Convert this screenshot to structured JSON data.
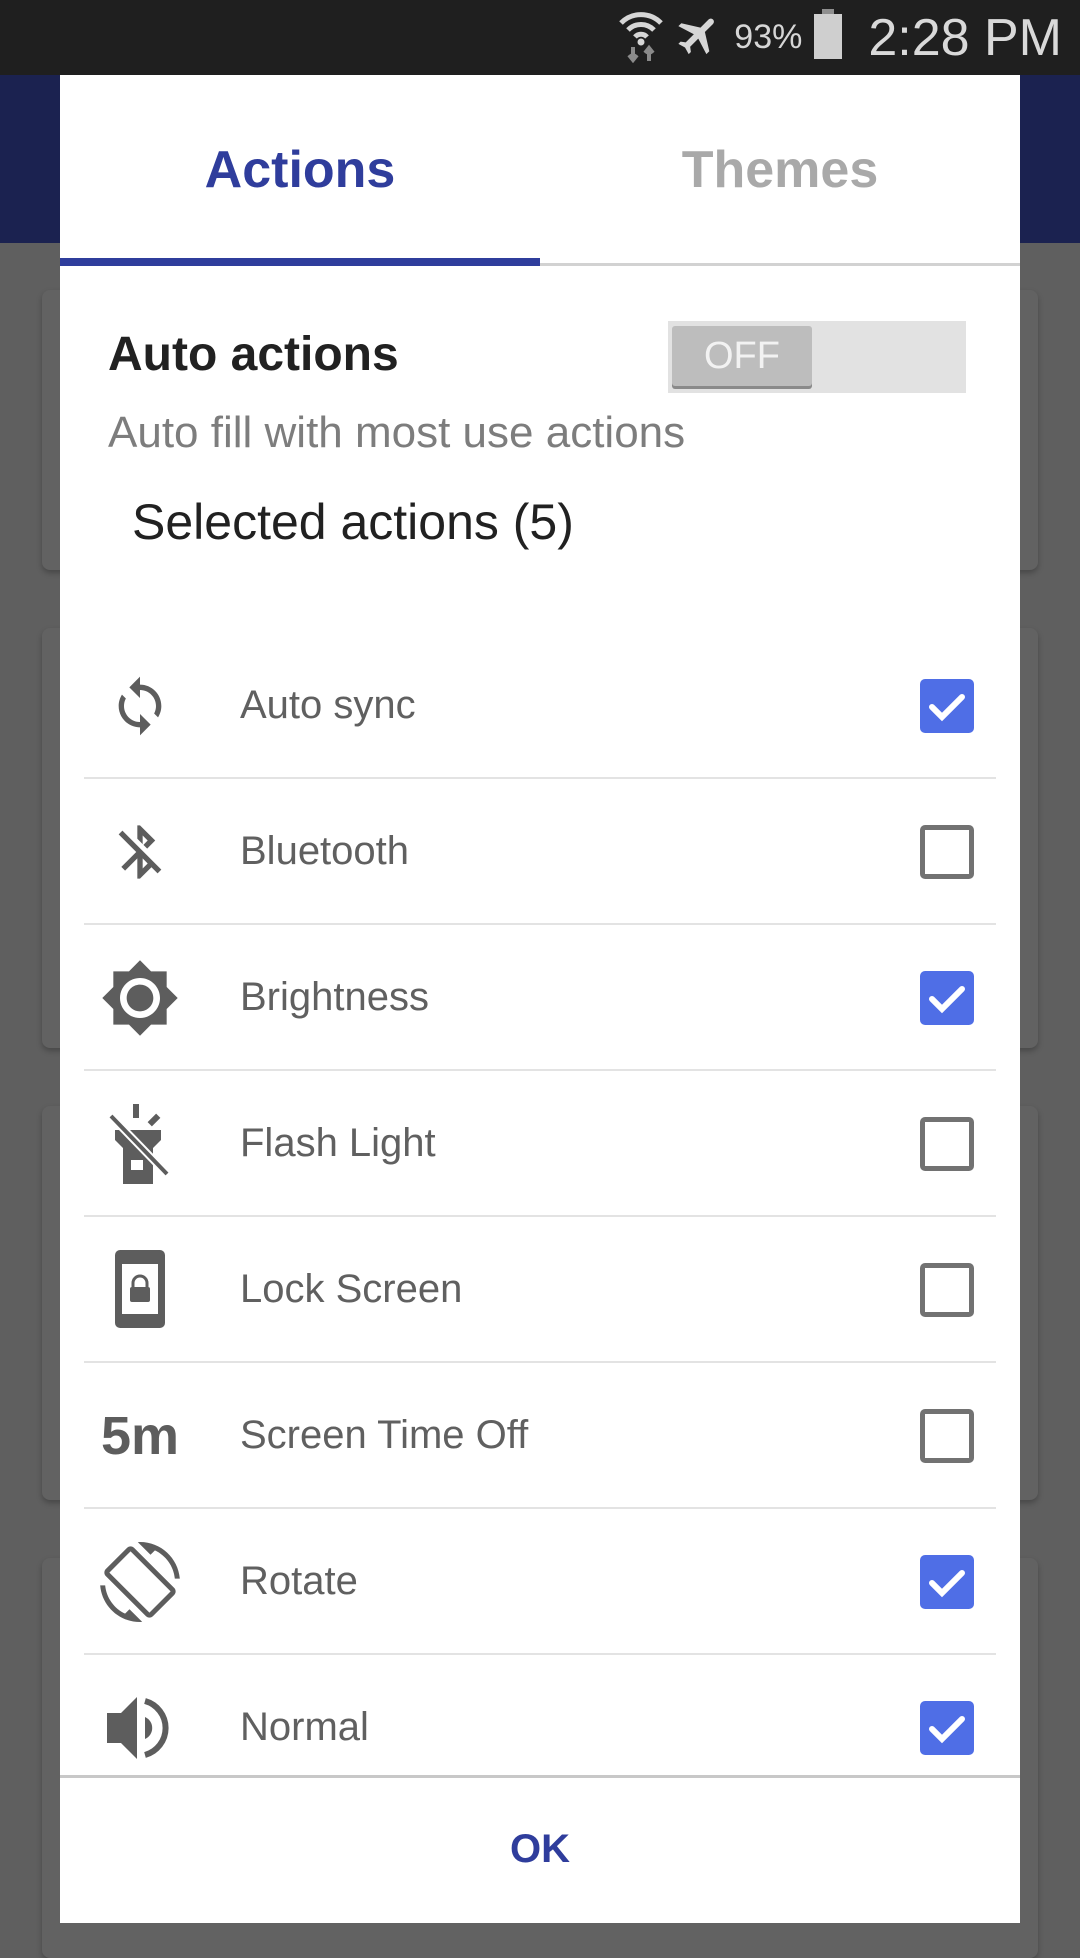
{
  "status_bar": {
    "battery_percent": "93%",
    "time": "2:28 PM",
    "icons": [
      "wifi-data-icon",
      "airplane-mode-icon",
      "battery-icon"
    ]
  },
  "tabs": [
    {
      "label": "Actions",
      "active": true
    },
    {
      "label": "Themes",
      "active": false
    }
  ],
  "auto_actions": {
    "title": "Auto actions",
    "subtitle": "Auto fill with most use actions",
    "toggle_label": "OFF",
    "toggle_on": false
  },
  "selected_actions": {
    "title": "Selected actions (5)",
    "items": [
      {
        "label": "Auto sync",
        "icon": "sync-icon",
        "checked": true
      },
      {
        "label": "Bluetooth",
        "icon": "bluetooth-off-icon",
        "checked": false
      },
      {
        "label": "Brightness",
        "icon": "brightness-icon",
        "checked": true
      },
      {
        "label": "Flash Light",
        "icon": "flashlight-off-icon",
        "checked": false
      },
      {
        "label": "Lock Screen",
        "icon": "lock-screen-icon",
        "checked": false
      },
      {
        "label": "Screen Time Off",
        "icon": "screen-timeout-icon",
        "icon_text": "5m",
        "checked": false
      },
      {
        "label": "Rotate",
        "icon": "screen-rotation-icon",
        "checked": true
      },
      {
        "label": "Normal",
        "icon": "volume-icon",
        "checked": true
      },
      {
        "label": "",
        "icon": "partial-icon",
        "checked": false
      }
    ]
  },
  "footer": {
    "ok_label": "OK"
  },
  "colors": {
    "accent": "#2f3d9c",
    "checkbox_on": "#4f6ee6",
    "appbar": "#1b2250"
  }
}
